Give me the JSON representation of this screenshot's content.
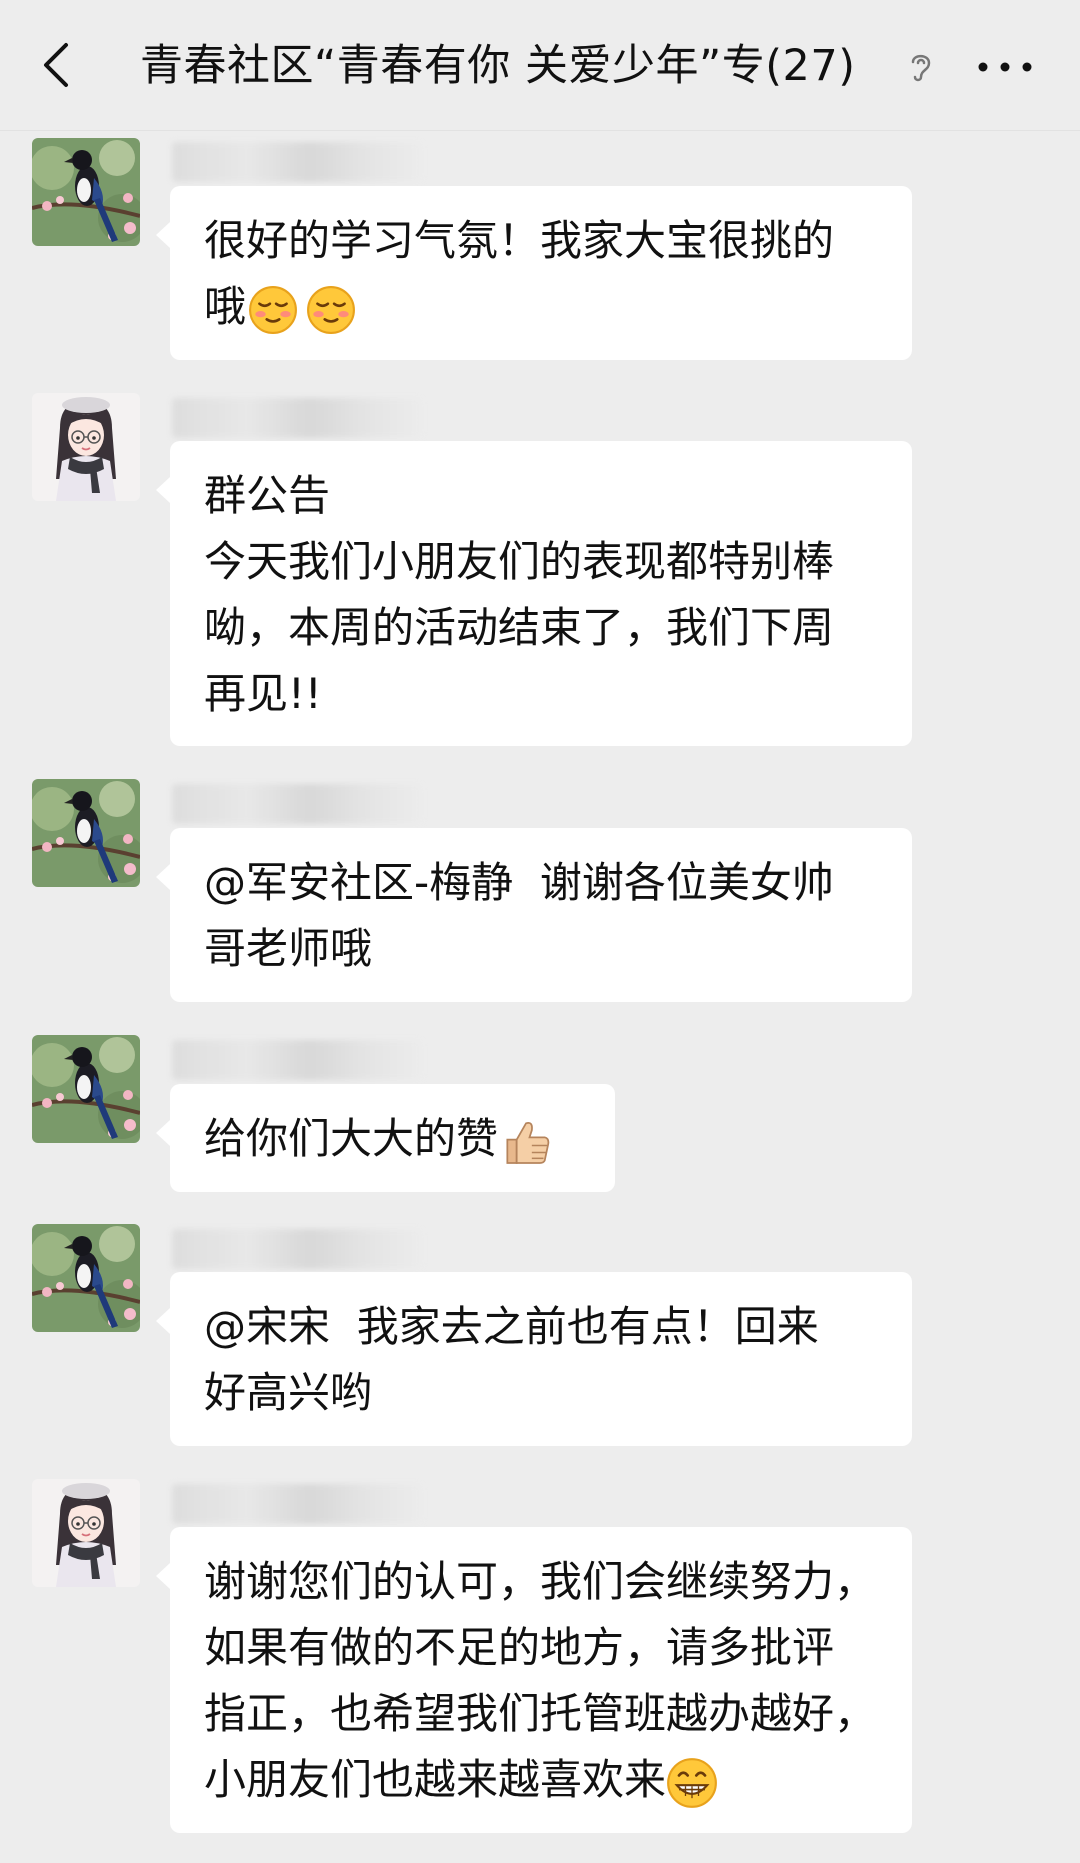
{
  "header": {
    "title": "青春社区“青春有你 关爱少年”专(27)"
  },
  "messages": [
    {
      "avatar": "magpie-avatar",
      "lines": [
        "很好的学习气氛！我家大宝很挑的",
        "哦"
      ],
      "emojis": [
        "blush-emoji",
        "blush-emoji"
      ]
    },
    {
      "avatar": "girl-avatar",
      "lines": [
        "群公告",
        "今天我们小朋友们的表现都特别棒",
        "呦，本周的活动结束了，我们下周",
        "再见!!"
      ]
    },
    {
      "avatar": "magpie-avatar",
      "lines": [
        "@军安社区-梅静  谢谢各位美女帅",
        "哥老师哦"
      ]
    },
    {
      "avatar": "magpie-avatar",
      "lines": [
        "给你们大大的赞"
      ],
      "emojis": [
        "thumbs-up-emoji"
      ]
    },
    {
      "avatar": "magpie-avatar",
      "lines": [
        "@宋宋  我家去之前也有点！回来",
        "好高兴哟"
      ]
    },
    {
      "avatar": "girl-avatar",
      "lines": [
        "谢谢您们的认可，我们会继续努力，",
        "如果有做的不足的地方，请多批评",
        "指正，也希望我们托管班越办越好，",
        "小朋友们也越来越喜欢来"
      ],
      "emojis": [
        "grin-emoji"
      ]
    }
  ]
}
